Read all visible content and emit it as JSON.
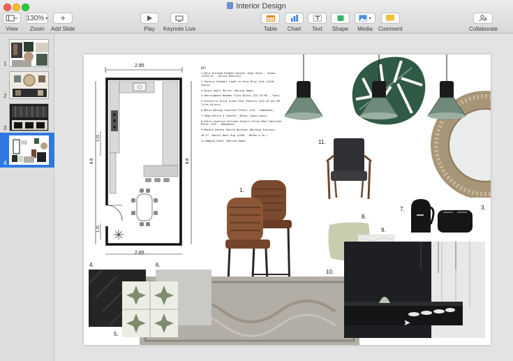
{
  "window": {
    "title": "Interior Design"
  },
  "toolbar": {
    "view": "View",
    "zoom_value": "130%",
    "zoom": "Zoom",
    "add_slide": "Add Slide",
    "play": "Play",
    "keynote_live": "Keynote Live",
    "table": "Table",
    "chart": "Chart",
    "text": "Text",
    "shape": "Shape",
    "media": "Media",
    "comment": "Comment",
    "collaborate": "Collaborate"
  },
  "slides": [
    {
      "number": "1"
    },
    {
      "number": "2"
    },
    {
      "number": "3"
    },
    {
      "number": "4"
    }
  ],
  "selected_slide": 4,
  "slide": {
    "key_title": "KEY",
    "key_items": [
      "1.Rila Vintage Ribbed Leather High Stool - Brown (£219.25 - Online Reality)",
      "2.Factory Pendant Light in Grey Blue Tint (£210 - Iatta)",
      "3.Brass Small Mirror (Marina Home)",
      "4.Herringbone Wooden Tiles Black (£21.45 M2 - Tbox)",
      "5.Scintilla Olive Green Star Pattern (£21.49 per M2 - Tiles Direct)",
      "6.Bolus Design Concrete Effect (£22 - Homebase)",
      "7.Smeg Kettle & Toaster, Black (John Lewis)",
      "8.Dulux Covelare Kitchen Drearly Olive Matt Emulsion Paint (£22 - Homebase)",
      "9.Marble Veneta Zenith Worktop (Worktop Express)",
      "10.17. Dazzil Wool Rug (£200 - McGee & Co.)",
      "11.Nagoya Chair (Marina Home)"
    ],
    "labels": {
      "n1": "1.",
      "n2": "2.",
      "n3": "3.",
      "n4": "4.",
      "n5": "5.",
      "n6": "6.",
      "n7": "7.",
      "n8": "8.",
      "n9": "9.",
      "n10": "10.",
      "n11": "11."
    },
    "plan": {
      "dim_top": "2.85",
      "dim_bottom": "2.85",
      "dim_left": "8.8",
      "dim_right": "8.8",
      "dim_upper": "4.15",
      "dim_lower": "1.25"
    }
  },
  "colors": {
    "accent": "#2f78e2",
    "leather": "#7a4a2e",
    "pendant": "#6f8a7b",
    "olive_paint": "#c9cdb0",
    "kitchen_black": "#1d1f22",
    "brass": "#a79578"
  },
  "icons": {
    "view": "sidebar-layout-icon",
    "add_slide": "plus-icon",
    "play": "play-icon",
    "keynote_live": "keynote-live-icon",
    "table": "table-icon",
    "chart": "bar-chart-icon",
    "text": "text-box-icon",
    "shape": "shape-icon",
    "media": "media-image-icon",
    "comment": "comment-icon",
    "collaborate": "collaborate-icon"
  }
}
